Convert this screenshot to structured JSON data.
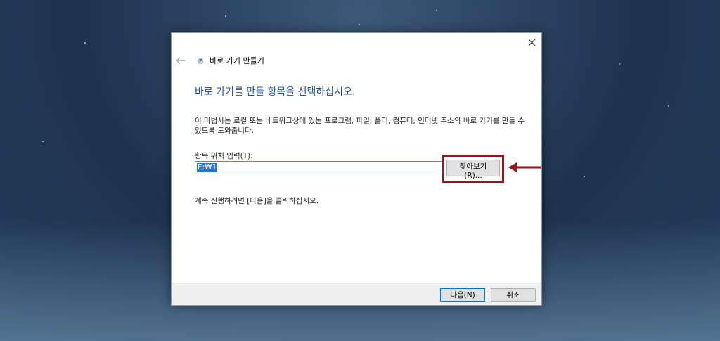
{
  "wizard": {
    "title": "바로 가기 만들기",
    "heading": "바로 가기를 만들 항목을 선택하십시오.",
    "description": "이 마법사는 로컬 또는 네트워크상에 있는 프로그램, 파일, 폴더, 컴퓨터, 인터넷 주소의 바로 가기를 만들 수 있도록 도와줍니다.",
    "location_label": "항목 위치 입력(T):",
    "location_value": "E:₩1",
    "browse_label": "찾아보기(R)...",
    "continue_note": "계속 진행하려면 [다음]을 클릭하십시오.",
    "next_label": "다음(N)",
    "cancel_label": "취소"
  },
  "icons": {
    "close": "close-icon",
    "back": "back-arrow-icon",
    "wizard": "shortcut-wizard-icon",
    "annotation": "red-arrow-icon"
  },
  "colors": {
    "heading": "#1c4f9c",
    "annotation": "#8e1a1e",
    "selection": "#2a74d6"
  }
}
